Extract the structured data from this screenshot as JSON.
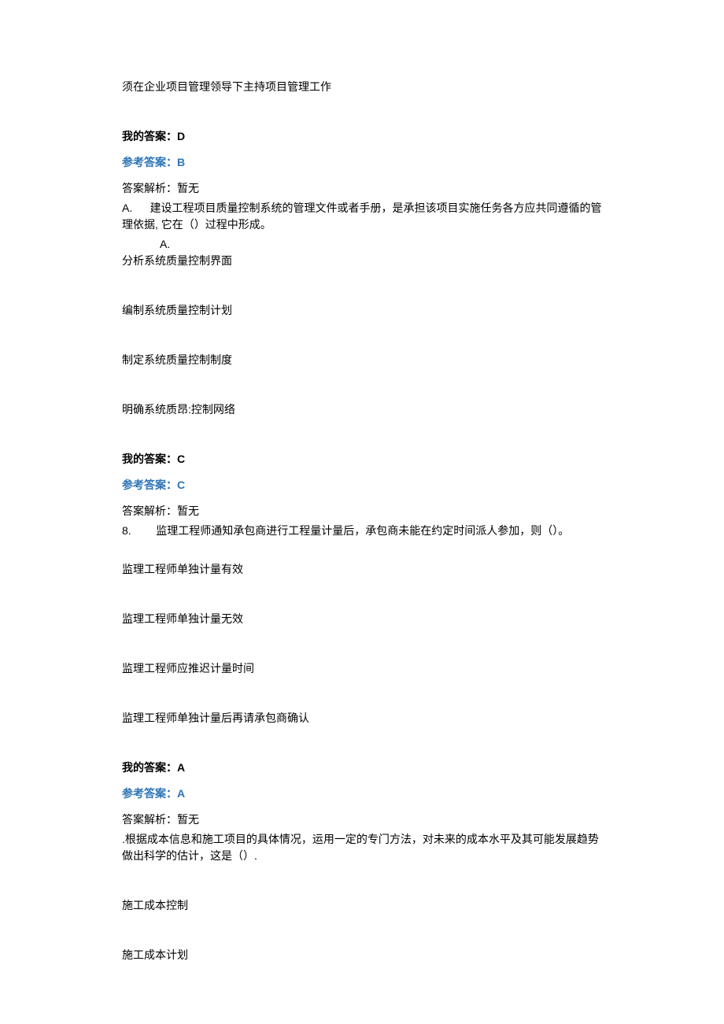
{
  "q6": {
    "tail_option": "须在企业项目管理领导下主持项目管理工作",
    "my_answer_label": "我的答案：",
    "my_answer_value": "D",
    "ref_answer_label": "参考答案：",
    "ref_answer_value": "B",
    "explain_label": "答案解析：",
    "explain_value": "暂无"
  },
  "q7": {
    "number_prefix": "A.",
    "stem": "建设工程项目质量控制系统的管理文件或者手册，是承担该项目实施任务各方应共同遵循的管理依据, 它在（）过程中形成。",
    "inner_label": "A.",
    "opt_a": "分析系统质量控制界面",
    "opt_b": "编制系统质量控制计划",
    "opt_c": "制定系统质量控制制度",
    "opt_d": "明确系统质昂:控制网络",
    "my_answer_label": "我的答案：",
    "my_answer_value": "C",
    "ref_answer_label": "参考答案：",
    "ref_answer_value": "C",
    "explain_label": "答案解析：",
    "explain_value": "暂无"
  },
  "q8": {
    "number_prefix": "8.",
    "stem": "监理工程师通知承包商进行工程量计量后，承包商未能在约定时间派人参加，则（）。",
    "opt_a": "监理工程师单独计量有效",
    "opt_b": "监理工程师单独计量无效",
    "opt_c": "监理工程师应推迟计量时间",
    "opt_d": "监理工程师单独计量后再请承包商确认",
    "my_answer_label": "我的答案：",
    "my_answer_value": "A",
    "ref_answer_label": "参考答案：",
    "ref_answer_value": "A",
    "explain_label": "答案解析：",
    "explain_value": "暂无"
  },
  "q9": {
    "stem": ".根据成本信息和施工项目的具体情况，运用一定的专门方法，对未来的成本水平及其可能发展趋势做出科学的估计，这是（）.",
    "opt_a": "施工成本控制",
    "opt_b": "施工成本计划"
  }
}
